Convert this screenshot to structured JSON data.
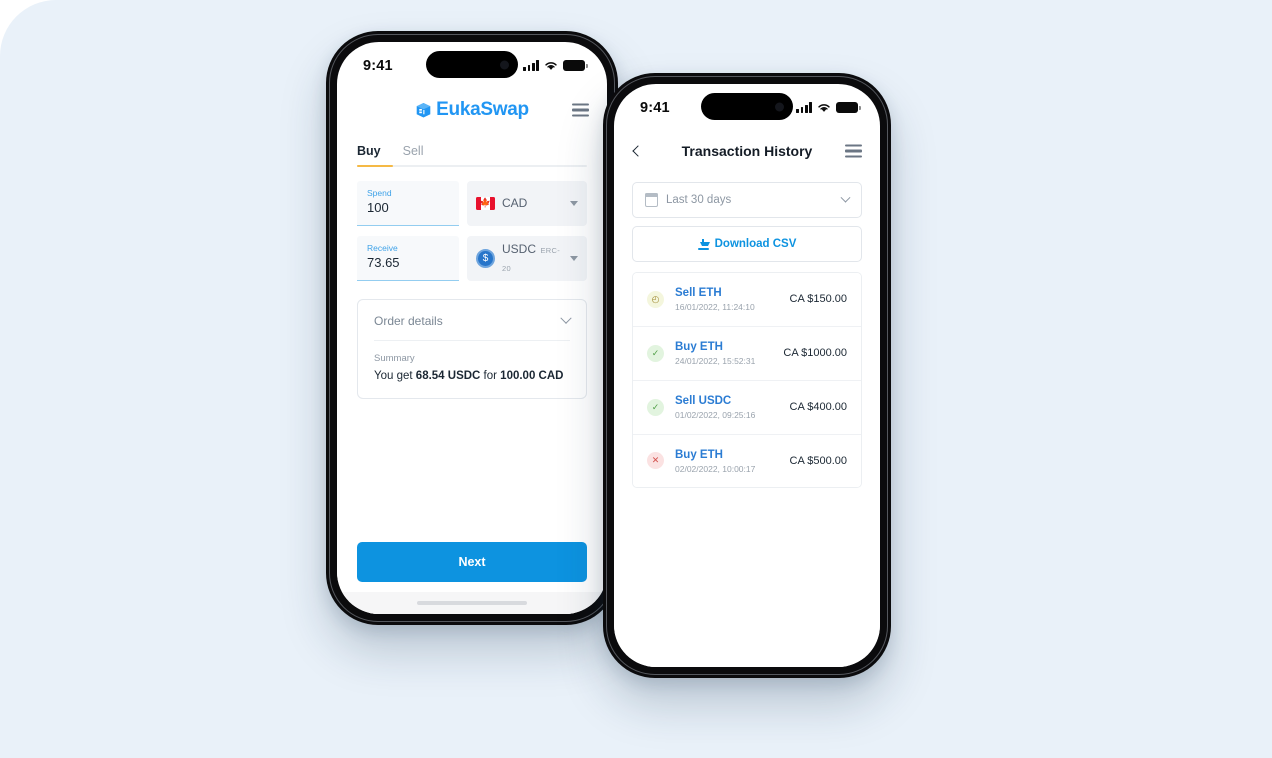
{
  "background_color": "#e9f1f9",
  "accent_color": "#0d93e0",
  "left_phone": {
    "status_bar": {
      "time": "9:41",
      "signal_icon": "signal-bars-icon",
      "wifi_icon": "wifi-icon",
      "battery_icon": "battery-icon"
    },
    "header": {
      "logo_icon": "eukaswap-cube-logo-icon",
      "brand": "EukaSwap",
      "menu_icon": "hamburger-menu-icon"
    },
    "tabs": [
      {
        "label": "Buy",
        "active": true
      },
      {
        "label": "Sell",
        "active": false
      }
    ],
    "spend": {
      "label": "Spend",
      "value": "100",
      "currency": "CAD",
      "currency_sub": "",
      "currency_icon": "canada-flag-icon",
      "caret_icon": "caret-down-icon"
    },
    "receive": {
      "label": "Receive",
      "value": "73.65",
      "currency": "USDC",
      "currency_sub": "ERC-20",
      "currency_icon": "usdc-coin-icon",
      "caret_icon": "caret-down-icon"
    },
    "order_details": {
      "title": "Order details",
      "expand_icon": "chevron-down-icon",
      "summary_label": "Summary",
      "summary_prefix": "You get ",
      "summary_amount": "68.54 USDC",
      "summary_middle": " for ",
      "summary_total": "100.00 CAD"
    },
    "next_button": "Next"
  },
  "right_phone": {
    "status_bar": {
      "time": "9:41",
      "signal_icon": "signal-bars-icon",
      "wifi_icon": "wifi-icon",
      "battery_icon": "battery-icon"
    },
    "nav": {
      "back_icon": "back-chevron-icon",
      "title": "Transaction History",
      "menu_icon": "hamburger-menu-icon"
    },
    "date_filter": {
      "icon": "calendar-icon",
      "label": "Last 30 days",
      "caret_icon": "chevron-down-icon"
    },
    "download": {
      "icon": "download-icon",
      "label": "Download CSV"
    },
    "transactions": [
      {
        "status": "pending",
        "status_icon": "clock-icon",
        "status_glyph": "◴",
        "title": "Sell ETH",
        "date": "16/01/2022, 11:24:10",
        "amount": "CA $150.00"
      },
      {
        "status": "success",
        "status_icon": "check-icon",
        "status_glyph": "✓",
        "title": "Buy ETH",
        "date": "24/01/2022, 15:52:31",
        "amount": "CA $1000.00"
      },
      {
        "status": "success",
        "status_icon": "check-icon",
        "status_glyph": "✓",
        "title": "Sell USDC",
        "date": "01/02/2022, 09:25:16",
        "amount": "CA $400.00"
      },
      {
        "status": "failed",
        "status_icon": "cross-icon",
        "status_glyph": "✕",
        "title": "Buy ETH",
        "date": "02/02/2022, 10:00:17",
        "amount": "CA $500.00"
      }
    ]
  }
}
